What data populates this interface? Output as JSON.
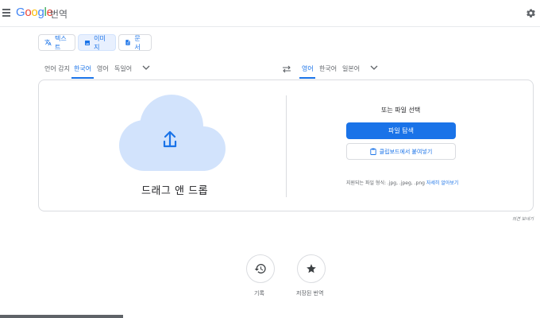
{
  "header": {
    "logo": "Google",
    "product": "번역"
  },
  "modes": [
    {
      "label": "텍스트",
      "icon": "translate-icon"
    },
    {
      "label": "이미지",
      "icon": "image-icon"
    },
    {
      "label": "문서",
      "icon": "document-icon"
    }
  ],
  "source_langs": [
    "언어 감지",
    "한국어",
    "영어",
    "독일어"
  ],
  "target_langs": [
    "영어",
    "한국어",
    "일본어"
  ],
  "upload": {
    "drag_text": "드래그 앤 드롭",
    "or_text": "또는 파일 선택",
    "browse_label": "파일 탐색",
    "paste_label": "클립보드에서 붙여넣기",
    "formats_text": "지원되는 파일 형식: .jpg, .jpeg, .png",
    "learn_more": "자세히 알아보기"
  },
  "feedback": "의견 보내기",
  "bottom": {
    "history_label": "기록",
    "saved_label": "저장된 번역"
  },
  "colors": {
    "accent": "#1a73e8",
    "cloud": "#d2e3fc",
    "active_bg": "#e8f0fe"
  }
}
